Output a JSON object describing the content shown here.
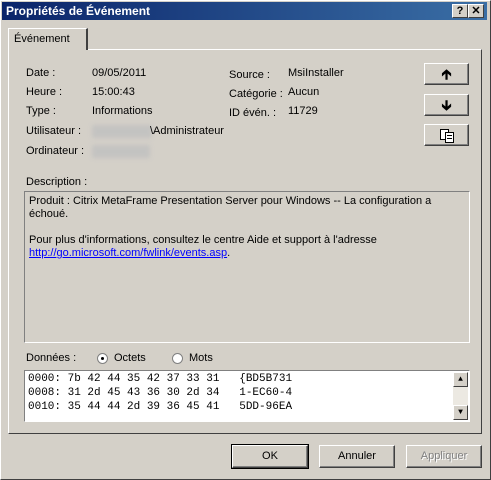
{
  "window": {
    "title": "Propriétés de Événement",
    "help_label": "?",
    "close_label": "✕"
  },
  "tab": {
    "label": "Événement"
  },
  "fields": {
    "date_label": "Date :",
    "date_value": "09/05/2011",
    "heure_label": "Heure :",
    "heure_value": "15:00:43",
    "type_label": "Type :",
    "type_value": "Informations",
    "user_label": "Utilisateur :",
    "user_value": "\\Administrateur",
    "computer_label": "Ordinateur :",
    "source_label": "Source :",
    "source_value": "MsiInstaller",
    "category_label": "Catégorie :",
    "category_value": "Aucun",
    "id_label": "ID évén. :",
    "id_value": "11729"
  },
  "side_buttons": {
    "up_icon": "arrow-up-icon",
    "down_icon": "arrow-down-icon",
    "copy_icon": "copy-icon"
  },
  "description": {
    "label": "Description :",
    "line1": "Produit : Citrix MetaFrame Presentation Server pour Windows -- La configuration a",
    "line2": "échoué.",
    "line3": "Pour plus d'informations, consultez le centre Aide et support à l'adresse",
    "link": "http://go.microsoft.com/fwlink/events.asp",
    "after_link": "."
  },
  "data_section": {
    "label": "Données :",
    "option_bytes": "Octets",
    "option_words": "Mots",
    "selected": "Octets",
    "lines": [
      "0000: 7b 42 44 35 42 37 33 31   {BD5B731",
      "0008: 31 2d 45 43 36 30 2d 34   1-EC60-4",
      "0010: 35 44 44 2d 39 36 45 41   5DD-96EA"
    ]
  },
  "buttons": {
    "ok": "OK",
    "cancel": "Annuler",
    "apply": "Appliquer"
  }
}
